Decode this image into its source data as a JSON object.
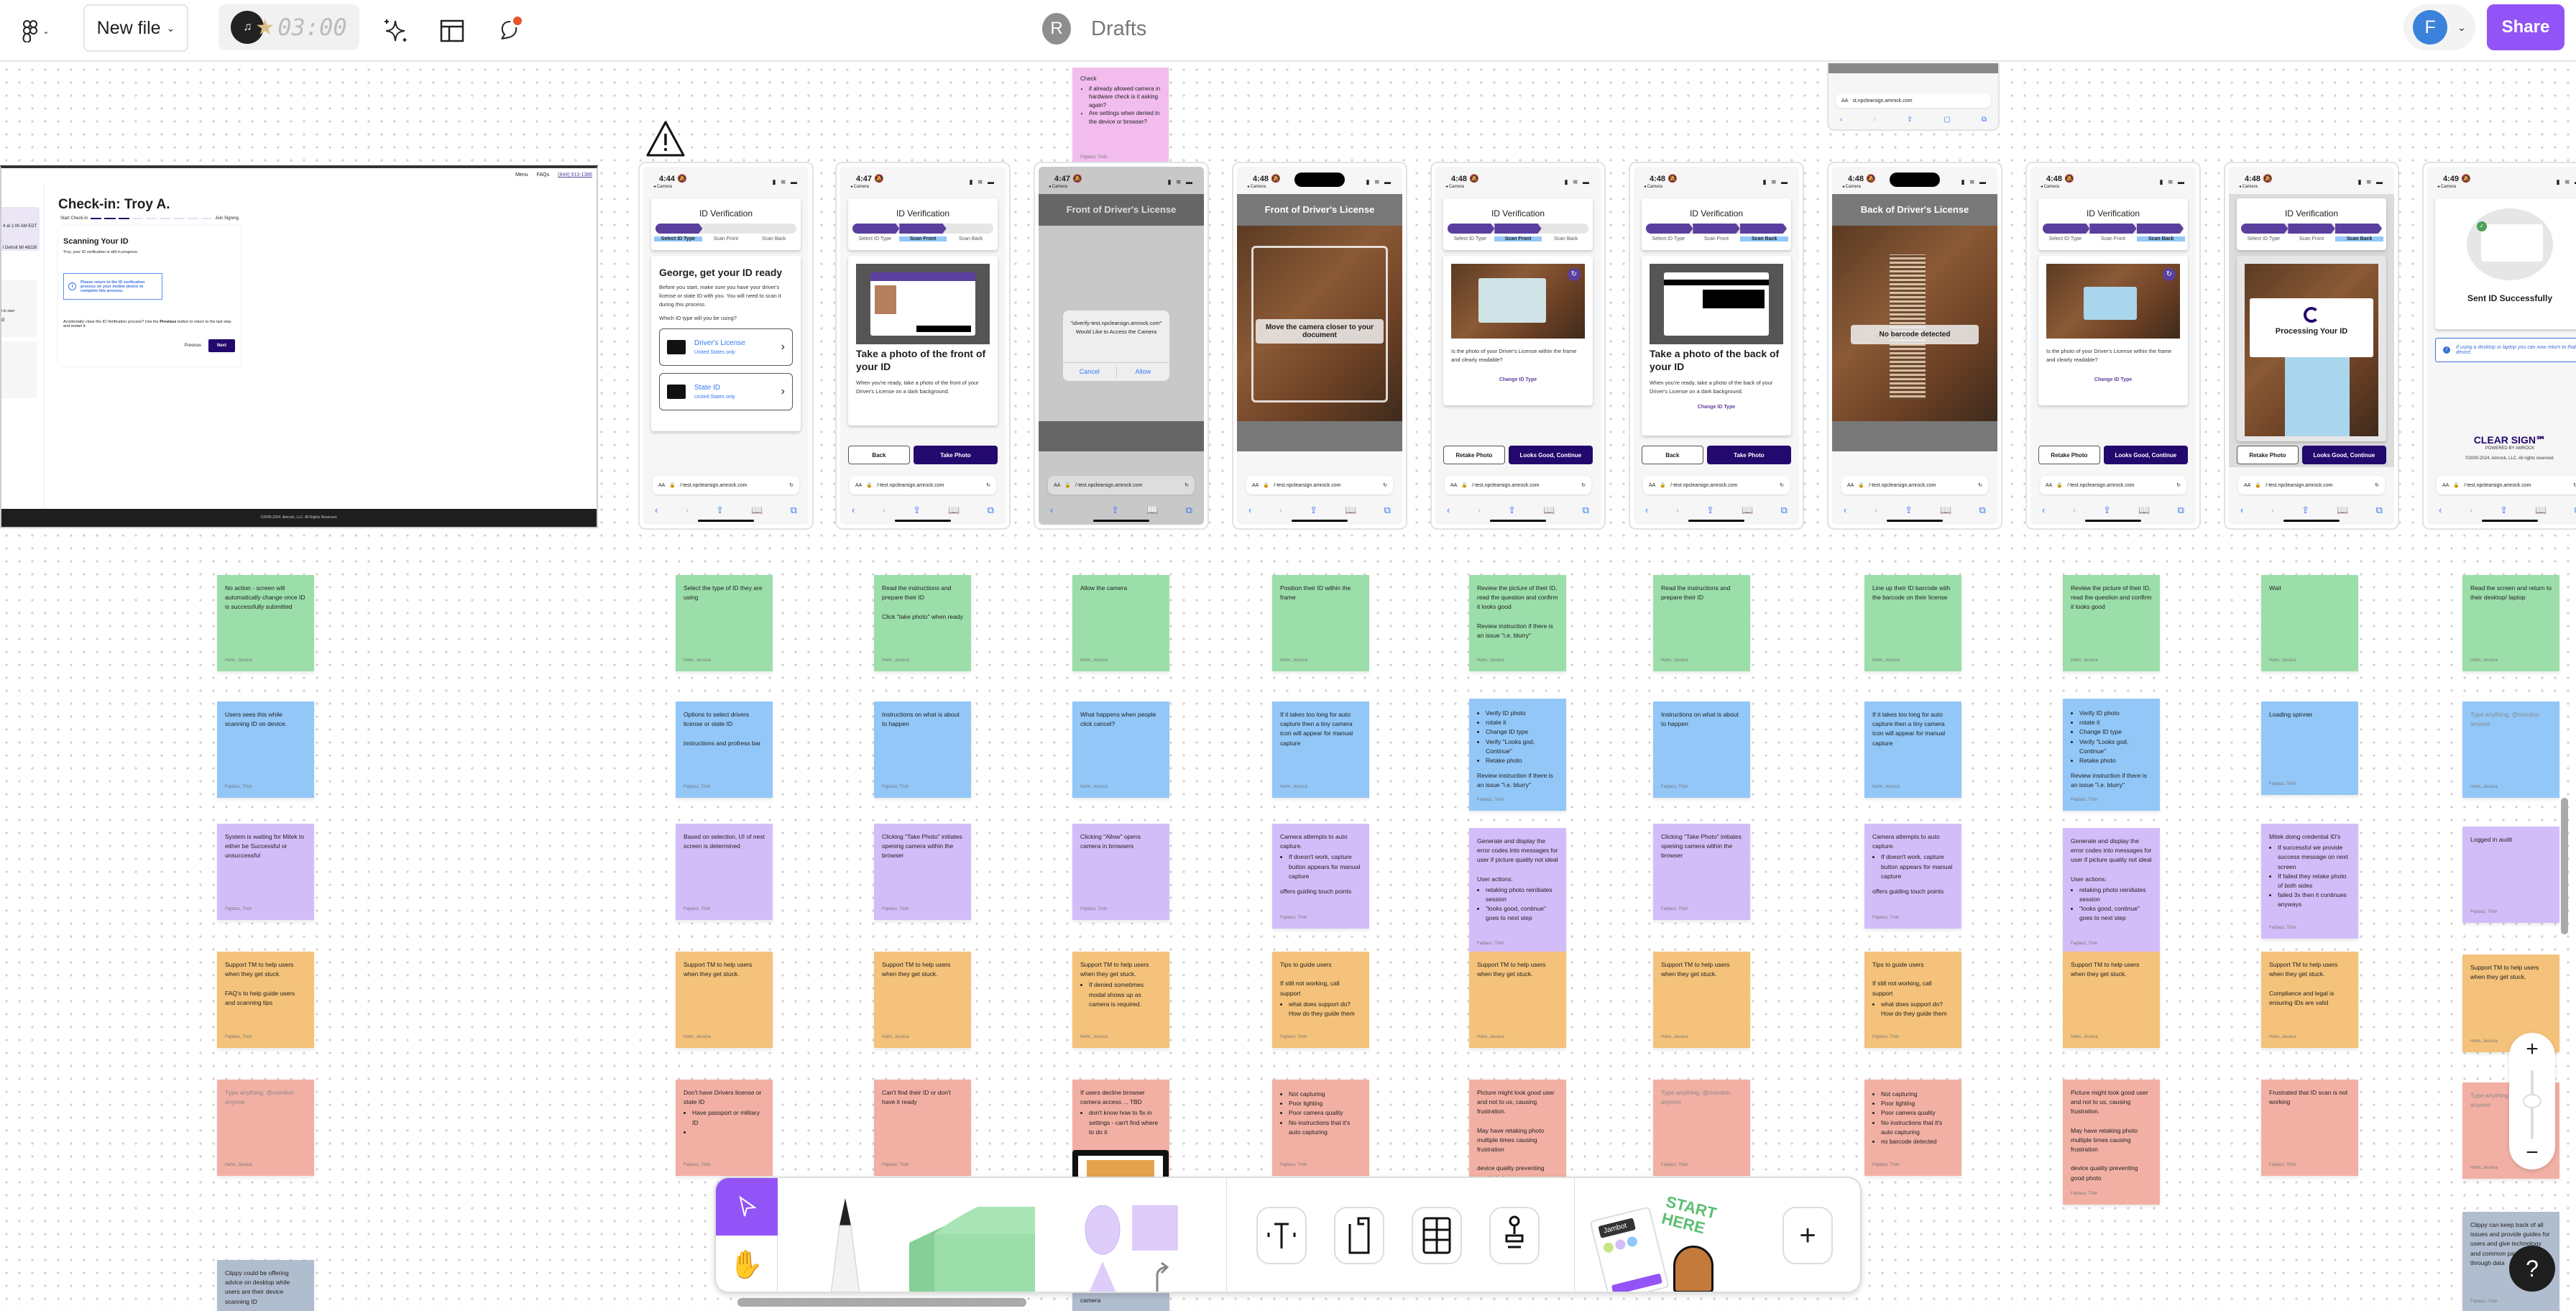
{
  "topbar": {
    "file_button": "New file",
    "timer": "03:00",
    "location_avatar": "R",
    "location": "Drafts",
    "user_avatar": "F",
    "share": "Share",
    "icons": [
      "figma-menu-icon",
      "chevron-down-icon",
      "music-timer-icon",
      "ai-sparkle-icon",
      "layout-icon",
      "comment-icon"
    ],
    "accent": "#9254f6"
  },
  "desktop": {
    "menu": "Menu",
    "faqs": "FAQs",
    "phone": "(844) 913-1386",
    "side1": "4 at 1:00 AM EDT",
    "side2": "l Detroit MI 48226",
    "side3": "t to start",
    "side4": "d",
    "title": "Check-in: Troy A.",
    "start": "Start Check-in",
    "end": "Join Signing",
    "progress_steps_done": 3,
    "progress_steps_total": 9,
    "card_title": "Scanning Your ID",
    "card_sub": "Troy, your ID verification is still in progress.",
    "info": "Please return to the ID verification process on your mobile device to complete this process.",
    "help_pre": "Accidentally close the ID Verification process? Use the ",
    "help_bold": "Previous",
    "help_post": " button to return to the last step and restart it.",
    "prev": "Previous",
    "next": "Next",
    "footer": "©2000-2024. Amrock, LLC. All Rights Reserved."
  },
  "phones": {
    "carrier": "◂ Camera",
    "url": "/-test.npclearsign.amrock.com",
    "url_short": "st.npclearsign.amrock.com",
    "aa": "AA",
    "id_title": "ID Verification",
    "steps": [
      "Select ID Type",
      "Scan Front",
      "Scan Back"
    ],
    "p1": {
      "time": "4:44",
      "heading": "George, get your ID ready",
      "body": "Before you start, make sure you have your driver's license or state ID with you. You will need to scan it during this process.",
      "question": "Which ID type will you be using?",
      "opt1": "Driver's License",
      "opt2": "State ID",
      "opt_sub": "United States only"
    },
    "p2": {
      "time": "4:47",
      "heading": "Take a photo of the front of your ID",
      "body": "When you're ready, take a photo of the front of your Driver's License on a dark background.",
      "back": "Back",
      "take": "Take Photo"
    },
    "p3": {
      "time": "4:47",
      "header": "Front of Driver's License",
      "dialog": "\"idverify-test.npclearsign.amrock.com\" Would Like to Access the Camera",
      "cancel": "Cancel",
      "allow": "Allow"
    },
    "p4": {
      "time": "4:48",
      "header": "Front of Driver's License",
      "hint": "Move the camera closer to your document"
    },
    "p5": {
      "time": "4:48",
      "question": "Is the photo of your Driver's License within the frame and clearly readable?",
      "change": "Change ID Type",
      "retake": "Retake Photo",
      "good": "Looks Good, Continue"
    },
    "p6": {
      "time": "4:48",
      "heading": "Take a photo of the back of your ID",
      "body": "When you're ready, take a photo of the back of your Driver's License on a dark background.",
      "change": "Change ID Type",
      "back": "Back",
      "take": "Take Photo"
    },
    "p7": {
      "time": "4:48",
      "header": "Back of Driver's License",
      "hint": "No barcode detected"
    },
    "p8": {
      "time": "4:48",
      "question": "Is the photo of your Driver's License within the frame and clearly readable?",
      "change": "Change ID Type",
      "retake": "Retake Photo",
      "good": "Looks Good, Continue"
    },
    "p9": {
      "time": "4:48",
      "processing": "Processing Your ID",
      "retake": "Retake Photo",
      "good": "Looks Good, Continue"
    },
    "p10": {
      "time": "4:49",
      "success": "Sent ID Successfully",
      "info": "If using a desktop or laptop you can now return to that device.",
      "brand": "CLEAR SIGN℠",
      "powered": "POWERED BY AMROCK",
      "copy": "©2000-2024. Amrock, LLC. All rights reserved."
    }
  },
  "top_sticky": {
    "title": "Check",
    "items": [
      "if already allowed camera in hardware check is it asking again?",
      "Are settings when denied in the device or browser?"
    ],
    "author": "Fejdasz, Trish"
  },
  "stickies": {
    "green": [
      {
        "text": "No action - screen will automatically change once ID is successfully submitted",
        "author": "Hahn, Jessica"
      },
      {
        "text": "Select the type of ID they are using",
        "author": "Hahn, Jessica"
      },
      {
        "text": "Read the instructions and prepare their ID\n\nClick \"take photo\" when ready",
        "author": "Hahn, Jessica"
      },
      {
        "text": "Allow the camera",
        "author": "Hahn, Jessica"
      },
      {
        "text": "Position their ID within the frame",
        "author": "Hahn, Jessica"
      },
      {
        "text": "Review the picture of their ID, read the question and confirm it looks good\n\nReview instruction if there is an issue \"i.e. blurry\"",
        "author": "Hahn, Jessica"
      },
      {
        "text": "Read the instructions and prepare their ID",
        "author": "Hahn, Jessica"
      },
      {
        "text": "Line up their ID barcode with the barcode on their license",
        "author": "Hahn, Jessica"
      },
      {
        "text": "Review the picture of their ID, read the question and confirm it looks good",
        "author": "Hahn, Jessica"
      },
      {
        "text": "Wait",
        "author": "Hahn, Jessica"
      },
      {
        "text": "Read the screen and return to their desktop/ laptop",
        "author": "Hahn, Jessica"
      }
    ],
    "blue": [
      {
        "text": "Users sees this while scanning ID on device.",
        "author": "Fejdasz, Trish"
      },
      {
        "text": "Options to select drivers license or state ID\n\ninstructions and profress bar",
        "author": "Fejdasz, Trish"
      },
      {
        "text": "Instructions on what is about to happen",
        "author": "Fejdasz, Trish"
      },
      {
        "text": "What happens when people click cancel?",
        "author": "Hahn, Jessica"
      },
      {
        "text": "If it takes too long for auto capture then a tiny camera icon will appear for manual capture",
        "author": "Hahn, Jessica"
      },
      {
        "list": [
          "Verify ID photo",
          "rotate it",
          "Change ID type",
          "Verify \"Looks god, Continue\"",
          "Retake photo"
        ],
        "text": "Review instruction if there is an issue \"i.e. blurry\"",
        "author": "Fejdasz, Trish"
      },
      {
        "text": "Instructions on what is about to happen",
        "author": "Fejdasz, Trish"
      },
      {
        "text": "If it takes too long for auto capture then a tiny camera icon will appear for manual capture",
        "author": "Hahn, Jessica"
      },
      {
        "list": [
          "Verify ID photo",
          "rotate it",
          "Change ID type",
          "Verify \"Looks god, Continue\"",
          "Retake photo"
        ],
        "text": "Review instruction if there is an issue \"i.e. blurry\"",
        "author": "Fejdasz, Trish"
      },
      {
        "text": "Loading spinner",
        "author": "Fejdasz, Trish"
      },
      {
        "text": "Type anything, @mention anyone",
        "placeholder": true,
        "author": "Hahn, Jessica"
      }
    ],
    "purple": [
      {
        "text": "System is waiting for Mitek to either be Successful or unsuccessful",
        "author": "Fejdasz, Trish"
      },
      {
        "text": "Based on selection, UI of next screen is determined",
        "author": "Fejdasz, Trish"
      },
      {
        "text": "Clicking \"Take Photo\" initiates opening camera within the browser",
        "author": "Fejdasz, Trish"
      },
      {
        "text": "Clicking \"Allow\" opens camera in browsers",
        "author": "Fejdasz, Trish"
      },
      {
        "text": "Camera attempts to auto capture.",
        "list": [
          "If doesn't work, capture button appears for manual capture"
        ],
        "text2": "offers guiding touch points",
        "author": "Fejdasz, Trish"
      },
      {
        "text": "Generate and display the error codes into messages for user if picture quality not ideal\n\nUser actions:",
        "list": [
          "retaking photo reinitiates session",
          "\"looks good, continue\" goes to next step"
        ],
        "author": "Fejdasz, Trish"
      },
      {
        "text": "Clicking \"Take Photo\" initiates opening camera within the browser",
        "author": "Fejdasz, Trish"
      },
      {
        "text": "Camera attempts to auto capture.",
        "list": [
          "If doesn't work, capture button appears for manual capture"
        ],
        "text2": "offers guiding touch points",
        "author": "Fejdasz, Trish"
      },
      {
        "text": "Generate and display the error codes into messages for user if picture quality not ideal\n\nUser actions:",
        "list": [
          "retaking photo reinitiates session",
          "\"looks good, continue\" goes to next step"
        ],
        "author": "Fejdasz, Trish"
      },
      {
        "text": "Mitek doing credential ID's",
        "list": [
          "If successful we provide success message on next screen",
          "If failed they retake photo of both sides",
          "failed 3x then it continues anyways"
        ],
        "author": "Fejdasz, Trish"
      },
      {
        "text": "Logged in audit",
        "author": "Fejdasz, Trish"
      }
    ],
    "orange": [
      {
        "text": "Support TM to help users when they get stuck.\n\nFAQ's to help guide users and scanning tips",
        "author": "Fejdasz, Trish"
      },
      {
        "text": "Support TM to help users when they get stuck.",
        "author": "Hahn, Jessica"
      },
      {
        "text": "Support TM to help users when they get stuck.",
        "author": "Hahn, Jessica"
      },
      {
        "text": "Support TM to help users when they get stuck.",
        "list": [
          "If denied sometimes modal shows up as camera is required."
        ],
        "author": "Hahn, Jessica"
      },
      {
        "text": "Tips to guide users\n\nIf still not working, call support",
        "list": [
          "what does support do? How do they guide them"
        ],
        "author": "Fejdasz, Trish"
      },
      {
        "text": "Support TM to help users when they get stuck.",
        "author": "Hahn, Jessica"
      },
      {
        "text": "Support TM to help users when they get stuck.",
        "author": "Hahn, Jessica"
      },
      {
        "text": "Tips to guide users\n\nIf still not working, call support",
        "list": [
          "what does support do? How do they guide them"
        ],
        "author": "Fejdasz, Trish"
      },
      {
        "text": "Support TM to help users when they get stuck.",
        "author": "Hahn, Jessica"
      },
      {
        "text": "Support TM to help users when they get stuck.\n\nCompliance and legal is ensuring IDs are valid",
        "author": "Hahn, Jessica"
      },
      {
        "text": "Support TM to help users when they get stuck.",
        "author": "Hahn, Jessica"
      }
    ],
    "red": [
      {
        "text": "Type anything, @mention anyone",
        "placeholder": true,
        "author": "Hahn, Jessica"
      },
      {
        "text": "Don't have Drivers license or state ID",
        "list": [
          "Have passport or military ID",
          ""
        ],
        "author": "Fejdasz, Trish"
      },
      {
        "text": "Can't find their ID or don't have it ready",
        "author": "Fejdasz, Trish"
      },
      {
        "text": "If users decline browser camera access ... TBD",
        "list": [
          "don't know how to fix in settings - can't find where to do it"
        ],
        "author": ""
      },
      {
        "list": [
          "Not capturing",
          "Poor lighting",
          "Poor camera quality",
          "No instructions that it's auto capturing"
        ],
        "author": "Fejdasz, Trish"
      },
      {
        "text": "Picture might look good user and not to us, causing frustration.\n\nMay have retaking photo multiple times causing frustration\n\ndevice quality preventing good photo",
        "author": ""
      },
      {
        "text": "Type anything, @mention anyone",
        "placeholder": true,
        "author": "Fejdasz, Trish"
      },
      {
        "list": [
          "Not capturing",
          "Poor lighting",
          "Poor camera quality",
          "No instructions that it's auto capturing",
          "no barcode detected"
        ],
        "author": "Fejdasz, Trish"
      },
      {
        "text": "Picture might look good user and not to us, causing frustration.\n\nMay have retaking photo multiple times causing frustration\n\ndevice quality preventing good photo",
        "author": "Fejdasz, Trish"
      },
      {
        "text": "Frustrated that ID scan is not working",
        "author": "Fejdasz, Trish"
      },
      {
        "text": "Type anything, @mention anyone",
        "placeholder": true,
        "author": "Hahn, Jessica"
      }
    ],
    "slate": [
      {
        "text": "Clippy could be offering advice on desktop while users are their device scanning ID",
        "author": ""
      },
      {
        "text": "how to resolve denied camera",
        "author": ""
      },
      {
        "text": "Clippy can keep track of all issues and provide guides for users and give technology and common pain points through data",
        "author": "Fejdasz, Trish"
      }
    ]
  },
  "toolbar": {
    "tools": [
      "select-tool",
      "hand-tool",
      "marker-tool",
      "sticky-note-tool",
      "shape-tool",
      "connector-tool",
      "text-tool",
      "section-tool",
      "table-tool",
      "stamp-tool",
      "templates-tool",
      "more-tool"
    ],
    "templates_label": "Jambot",
    "sticker": "START HERE"
  },
  "zoom_controls": {
    "plus": "+",
    "minus": "−",
    "level": 0.55
  },
  "help": "?"
}
